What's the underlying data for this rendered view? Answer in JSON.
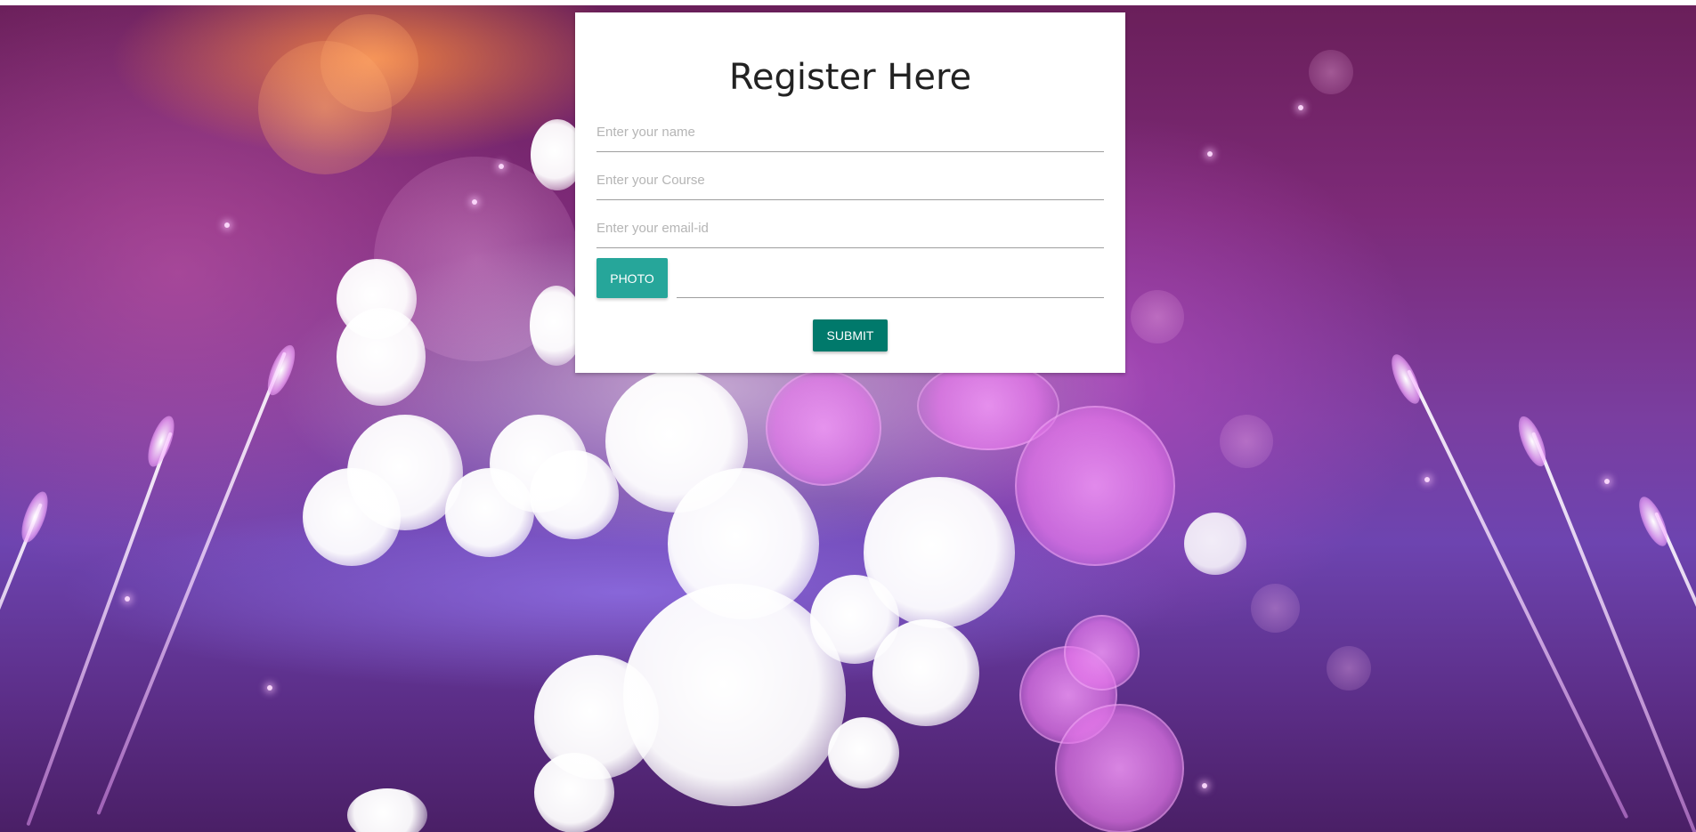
{
  "form": {
    "title": "Register Here",
    "name_placeholder": "Enter your name",
    "course_placeholder": "Enter your Course",
    "email_placeholder": "Enter your email-id",
    "photo_button_label": "PHOTO",
    "submit_button_label": "SUBMIT"
  },
  "colors": {
    "photo_button": "#26a69a",
    "submit_button": "#00796b",
    "background_theme": "purple-pink bokeh"
  }
}
